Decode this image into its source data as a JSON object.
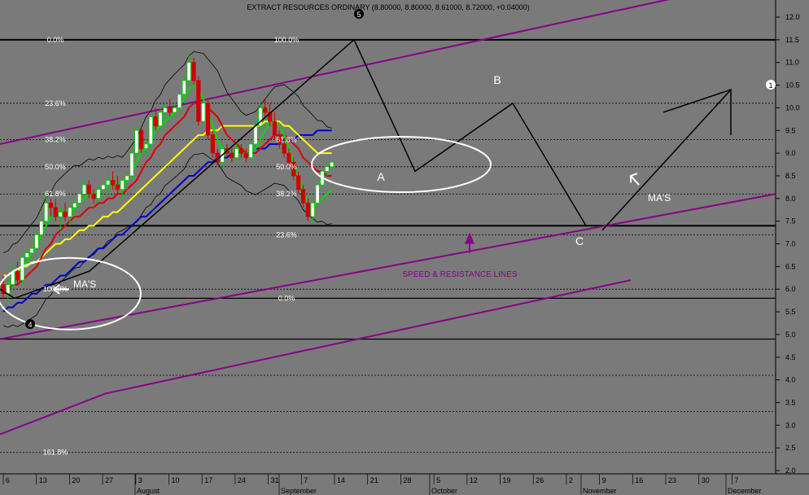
{
  "title": "EXTRACT RESOURCES ORDINARY (8.80000, 8.80000, 8.61000, 8.72000, +0.04000)",
  "colors": {
    "background": "#7a7a7a",
    "up_candle": "#00cc00",
    "down_candle": "#cc0000",
    "ma_fast": "#00dd00",
    "ma_mid": "#dd0000",
    "ma_slow": "#ffff00",
    "ma_long": "#0000cc",
    "channel": "#880088",
    "annotation": "#000000",
    "ellipse": "#ffffff"
  },
  "chart_data": {
    "type": "candlestick",
    "y_axis": {
      "ticks": [
        "12.0",
        "11.5",
        "11.0",
        "10.5",
        "10.0",
        "9.5",
        "9.0",
        "8.5",
        "8.0",
        "7.5",
        "7.0",
        "6.5",
        "6.0",
        "5.5",
        "5.0",
        "4.5",
        "4.0",
        "3.5",
        "3.0",
        "2.5",
        "2.0"
      ],
      "ylim": [
        2.0,
        12.0
      ]
    },
    "x_axis": {
      "day_ticks": [
        "6",
        "13",
        "20",
        "27",
        "3",
        "10",
        "17",
        "24",
        "31",
        "7",
        "14",
        "21",
        "28",
        "5",
        "12",
        "19",
        "26",
        "2",
        "9",
        "16",
        "23",
        "30",
        "7"
      ],
      "months": [
        "August",
        "September",
        "October",
        "November",
        "December"
      ]
    },
    "candles": [
      {
        "o": 6.1,
        "h": 6.3,
        "l": 5.8,
        "c": 5.9
      },
      {
        "o": 5.9,
        "h": 6.2,
        "l": 5.7,
        "c": 6.1
      },
      {
        "o": 6.1,
        "h": 6.5,
        "l": 6.0,
        "c": 6.4
      },
      {
        "o": 6.4,
        "h": 6.6,
        "l": 6.1,
        "c": 6.2
      },
      {
        "o": 6.2,
        "h": 6.8,
        "l": 6.1,
        "c": 6.7
      },
      {
        "o": 6.7,
        "h": 6.9,
        "l": 6.5,
        "c": 6.8
      },
      {
        "o": 6.8,
        "h": 7.0,
        "l": 6.6,
        "c": 6.9
      },
      {
        "o": 6.9,
        "h": 7.3,
        "l": 6.8,
        "c": 7.2
      },
      {
        "o": 7.2,
        "h": 7.6,
        "l": 7.0,
        "c": 7.5
      },
      {
        "o": 7.5,
        "h": 8.1,
        "l": 7.4,
        "c": 7.9
      },
      {
        "o": 7.9,
        "h": 8.0,
        "l": 7.6,
        "c": 7.8
      },
      {
        "o": 7.8,
        "h": 8.0,
        "l": 7.5,
        "c": 7.6
      },
      {
        "o": 7.6,
        "h": 7.8,
        "l": 7.3,
        "c": 7.7
      },
      {
        "o": 7.7,
        "h": 7.9,
        "l": 7.5,
        "c": 7.6
      },
      {
        "o": 7.6,
        "h": 7.8,
        "l": 7.4,
        "c": 7.8
      },
      {
        "o": 7.8,
        "h": 8.0,
        "l": 7.6,
        "c": 7.9
      },
      {
        "o": 7.9,
        "h": 8.2,
        "l": 7.8,
        "c": 8.1
      },
      {
        "o": 8.1,
        "h": 8.4,
        "l": 8.0,
        "c": 8.3
      },
      {
        "o": 8.3,
        "h": 8.4,
        "l": 8.0,
        "c": 8.1
      },
      {
        "o": 8.1,
        "h": 8.2,
        "l": 7.9,
        "c": 8.0
      },
      {
        "o": 8.0,
        "h": 8.3,
        "l": 7.9,
        "c": 8.2
      },
      {
        "o": 8.2,
        "h": 8.4,
        "l": 8.0,
        "c": 8.3
      },
      {
        "o": 8.3,
        "h": 8.5,
        "l": 8.1,
        "c": 8.4
      },
      {
        "o": 8.4,
        "h": 8.6,
        "l": 8.2,
        "c": 8.3
      },
      {
        "o": 8.3,
        "h": 8.5,
        "l": 8.1,
        "c": 8.2
      },
      {
        "o": 8.2,
        "h": 8.4,
        "l": 8.0,
        "c": 8.4
      },
      {
        "o": 8.4,
        "h": 8.6,
        "l": 8.2,
        "c": 8.5
      },
      {
        "o": 8.5,
        "h": 9.1,
        "l": 8.4,
        "c": 9.0
      },
      {
        "o": 9.0,
        "h": 9.6,
        "l": 8.9,
        "c": 9.5
      },
      {
        "o": 9.5,
        "h": 9.6,
        "l": 9.0,
        "c": 9.1
      },
      {
        "o": 9.1,
        "h": 9.3,
        "l": 8.9,
        "c": 9.2
      },
      {
        "o": 9.2,
        "h": 9.9,
        "l": 9.1,
        "c": 9.8
      },
      {
        "o": 9.8,
        "h": 10.0,
        "l": 9.5,
        "c": 9.6
      },
      {
        "o": 9.6,
        "h": 10.0,
        "l": 9.5,
        "c": 9.9
      },
      {
        "o": 9.9,
        "h": 10.1,
        "l": 9.7,
        "c": 10.0
      },
      {
        "o": 10.0,
        "h": 10.2,
        "l": 9.8,
        "c": 9.9
      },
      {
        "o": 9.9,
        "h": 10.1,
        "l": 9.8,
        "c": 10.0
      },
      {
        "o": 10.0,
        "h": 10.4,
        "l": 9.9,
        "c": 10.3
      },
      {
        "o": 10.3,
        "h": 10.7,
        "l": 10.1,
        "c": 10.6
      },
      {
        "o": 10.6,
        "h": 11.2,
        "l": 10.5,
        "c": 11.0
      },
      {
        "o": 11.0,
        "h": 11.1,
        "l": 10.5,
        "c": 10.6
      },
      {
        "o": 10.6,
        "h": 10.7,
        "l": 9.6,
        "c": 9.7
      },
      {
        "o": 9.7,
        "h": 10.3,
        "l": 9.6,
        "c": 10.1
      },
      {
        "o": 10.1,
        "h": 10.2,
        "l": 9.3,
        "c": 9.4
      },
      {
        "o": 9.4,
        "h": 9.5,
        "l": 8.9,
        "c": 9.0
      },
      {
        "o": 9.0,
        "h": 9.1,
        "l": 8.7,
        "c": 8.8
      },
      {
        "o": 8.8,
        "h": 9.2,
        "l": 8.7,
        "c": 9.1
      },
      {
        "o": 9.1,
        "h": 9.2,
        "l": 8.9,
        "c": 9.0
      },
      {
        "o": 9.0,
        "h": 9.1,
        "l": 8.8,
        "c": 8.9
      },
      {
        "o": 8.9,
        "h": 9.2,
        "l": 8.8,
        "c": 9.1
      },
      {
        "o": 9.1,
        "h": 9.2,
        "l": 8.9,
        "c": 9.0
      },
      {
        "o": 9.0,
        "h": 9.1,
        "l": 8.8,
        "c": 8.9
      },
      {
        "o": 8.9,
        "h": 9.3,
        "l": 8.8,
        "c": 9.2
      },
      {
        "o": 9.2,
        "h": 9.8,
        "l": 9.1,
        "c": 9.6
      },
      {
        "o": 9.6,
        "h": 10.1,
        "l": 9.5,
        "c": 10.0
      },
      {
        "o": 10.0,
        "h": 10.2,
        "l": 9.8,
        "c": 9.9
      },
      {
        "o": 9.9,
        "h": 10.1,
        "l": 9.6,
        "c": 9.7
      },
      {
        "o": 9.7,
        "h": 9.9,
        "l": 9.3,
        "c": 9.4
      },
      {
        "o": 9.4,
        "h": 9.5,
        "l": 9.1,
        "c": 9.2
      },
      {
        "o": 9.2,
        "h": 9.3,
        "l": 8.9,
        "c": 9.0
      },
      {
        "o": 9.0,
        "h": 9.1,
        "l": 8.7,
        "c": 8.8
      },
      {
        "o": 8.8,
        "h": 8.9,
        "l": 8.4,
        "c": 8.5
      },
      {
        "o": 8.5,
        "h": 8.6,
        "l": 8.1,
        "c": 8.2
      },
      {
        "o": 8.2,
        "h": 8.3,
        "l": 7.8,
        "c": 7.9
      },
      {
        "o": 7.9,
        "h": 8.0,
        "l": 7.5,
        "c": 7.6
      },
      {
        "o": 7.6,
        "h": 8.0,
        "l": 7.5,
        "c": 7.9
      },
      {
        "o": 7.9,
        "h": 8.4,
        "l": 7.8,
        "c": 8.3
      },
      {
        "o": 8.3,
        "h": 8.7,
        "l": 8.2,
        "c": 8.6
      },
      {
        "o": 8.6,
        "h": 8.8,
        "l": 8.5,
        "c": 8.7
      },
      {
        "o": 8.7,
        "h": 8.8,
        "l": 8.6,
        "c": 8.8
      }
    ],
    "moving_averages": [
      {
        "name": "MA fast",
        "color": "#00dd00",
        "values": [
          6.0,
          6.1,
          6.2,
          6.3,
          6.5,
          6.6,
          6.8,
          7.0,
          7.2,
          7.4,
          7.6,
          7.6,
          7.7,
          7.7,
          7.7,
          7.8,
          7.9,
          8.0,
          8.1,
          8.1,
          8.2,
          8.2,
          8.3,
          8.3,
          8.3,
          8.4,
          8.4,
          8.6,
          8.8,
          9.0,
          9.1,
          9.3,
          9.5,
          9.6,
          9.7,
          9.8,
          9.9,
          10.0,
          10.2,
          10.4,
          10.5,
          10.4,
          10.2,
          9.9,
          9.6,
          9.3,
          9.1,
          9.0,
          9.0,
          9.0,
          9.0,
          9.0,
          9.0,
          9.1,
          9.3,
          9.5,
          9.7,
          9.7,
          9.6,
          9.4,
          9.1,
          8.8,
          8.5,
          8.2,
          7.9,
          7.8,
          7.9,
          8.0,
          8.1,
          8.2
        ]
      },
      {
        "name": "MA mid",
        "color": "#dd0000",
        "values": [
          6.0,
          6.0,
          6.1,
          6.1,
          6.2,
          6.3,
          6.4,
          6.5,
          6.7,
          6.9,
          7.0,
          7.2,
          7.3,
          7.4,
          7.5,
          7.6,
          7.6,
          7.7,
          7.8,
          7.8,
          7.9,
          7.9,
          8.0,
          8.0,
          8.1,
          8.1,
          8.2,
          8.3,
          8.4,
          8.6,
          8.8,
          8.9,
          9.1,
          9.2,
          9.4,
          9.5,
          9.6,
          9.7,
          9.8,
          10.0,
          10.1,
          10.1,
          10.1,
          10.0,
          9.9,
          9.8,
          9.6,
          9.4,
          9.3,
          9.2,
          9.1,
          9.0,
          9.0,
          9.0,
          9.1,
          9.2,
          9.3,
          9.4,
          9.4,
          9.4,
          9.3,
          9.2,
          9.1,
          8.9,
          8.8,
          8.7,
          8.6,
          8.6,
          8.5,
          8.5
        ]
      },
      {
        "name": "MA slow",
        "color": "#ffff00",
        "values": [
          6.3,
          6.3,
          6.4,
          6.4,
          6.5,
          6.5,
          6.6,
          6.6,
          6.7,
          6.8,
          6.9,
          7.0,
          7.0,
          7.1,
          7.1,
          7.2,
          7.3,
          7.3,
          7.4,
          7.4,
          7.5,
          7.6,
          7.6,
          7.7,
          7.7,
          7.8,
          7.9,
          8.0,
          8.1,
          8.2,
          8.3,
          8.4,
          8.5,
          8.6,
          8.7,
          8.8,
          8.9,
          9.0,
          9.1,
          9.2,
          9.3,
          9.4,
          9.4,
          9.5,
          9.5,
          9.5,
          9.6,
          9.6,
          9.6,
          9.6,
          9.6,
          9.6,
          9.6,
          9.6,
          9.6,
          9.7,
          9.7,
          9.7,
          9.7,
          9.6,
          9.6,
          9.5,
          9.4,
          9.3,
          9.2,
          9.1,
          9.0,
          9.0,
          9.0,
          9.0
        ]
      },
      {
        "name": "MA long",
        "color": "#0000cc",
        "values": [
          5.5,
          5.6,
          5.6,
          5.7,
          5.7,
          5.8,
          5.9,
          5.9,
          6.0,
          6.1,
          6.1,
          6.2,
          6.3,
          6.3,
          6.4,
          6.5,
          6.6,
          6.6,
          6.7,
          6.8,
          6.9,
          6.9,
          7.0,
          7.1,
          7.2,
          7.2,
          7.3,
          7.4,
          7.5,
          7.6,
          7.6,
          7.7,
          7.8,
          7.9,
          8.0,
          8.1,
          8.2,
          8.3,
          8.4,
          8.5,
          8.5,
          8.6,
          8.7,
          8.8,
          8.8,
          8.9,
          8.9,
          8.9,
          9.0,
          9.0,
          9.0,
          9.0,
          9.0,
          9.1,
          9.1,
          9.1,
          9.2,
          9.2,
          9.2,
          9.3,
          9.3,
          9.3,
          9.4,
          9.4,
          9.4,
          9.4,
          9.5,
          9.5,
          9.5,
          9.5
        ]
      }
    ],
    "fib_levels_left": [
      {
        "label": "0.0%",
        "value": 11.5
      },
      {
        "label": "23.6%",
        "value": 10.1
      },
      {
        "label": "38.2%",
        "value": 9.3
      },
      {
        "label": "50.0%",
        "value": 8.7
      },
      {
        "label": "61.8%",
        "value": 8.1
      },
      {
        "label": "100.0%",
        "value": 6.0
      },
      {
        "label": "161.8%",
        "value": 2.4
      }
    ],
    "fib_levels_mid": [
      {
        "label": "100.0%",
        "value": 11.5
      },
      {
        "label": "61.8%",
        "value": 9.3
      },
      {
        "label": "50.0%",
        "value": 8.7
      },
      {
        "label": "38.2%",
        "value": 8.1
      },
      {
        "label": "23.6%",
        "value": 7.2
      },
      {
        "label": "0.0%",
        "value": 5.8
      }
    ],
    "annotations": {
      "wave_5": "5",
      "wave_4": "4",
      "wave_1": "1",
      "point_a": "A",
      "point_b": "B",
      "point_c": "C",
      "mas_left": "MA'S",
      "mas_right": "MA'S",
      "speed_lines": "SPEED & RESISTANCE LINES"
    }
  }
}
